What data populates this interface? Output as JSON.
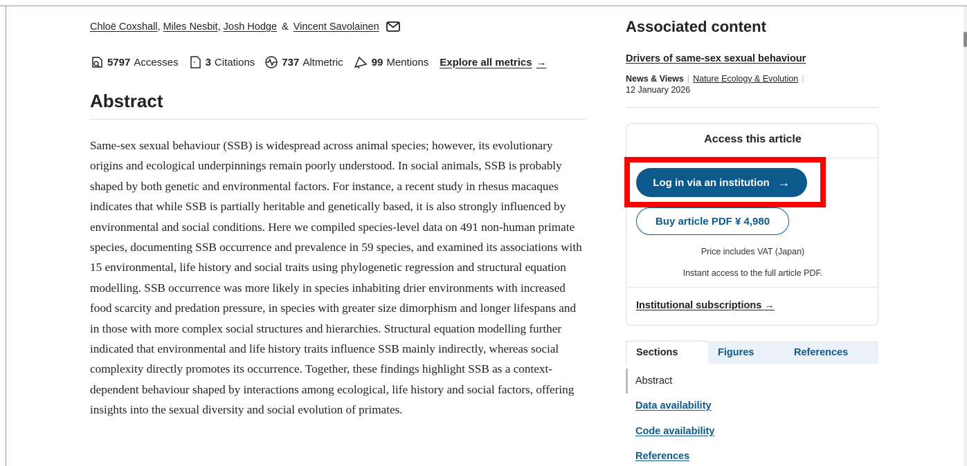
{
  "authors": [
    {
      "name": "Chloë Coxshall"
    },
    {
      "name": "Miles Nesbit"
    },
    {
      "name": "Josh Hodge"
    },
    {
      "name": "Vincent Savolainen"
    }
  ],
  "authors_sep": ",",
  "authors_amp": "&",
  "metrics": {
    "accesses_value": "5797",
    "accesses_label": "Accesses",
    "citations_value": "3",
    "citations_label": "Citations",
    "altmetric_value": "737",
    "altmetric_label": "Altmetric",
    "mentions_value": "99",
    "mentions_label": "Mentions",
    "explore_label": "Explore all metrics",
    "explore_arrow": "→"
  },
  "abstract": {
    "title": "Abstract",
    "body": "Same-sex sexual behaviour (SSB) is widespread across animal species; however, its evolutionary origins and ecological underpinnings remain poorly understood. In social animals, SSB is probably shaped by both genetic and environmental factors. For instance, a recent study in rhesus macaques indicates that while SSB is partially heritable and genetically based, it is also strongly influenced by environmental and social conditions. Here we compiled species-level data on 491 non-human primate species, documenting SSB occurrence and prevalence in 59 species, and examined its associations with 15 environmental, life history and social traits using phylogenetic regression and structural equation modelling. SSB occurrence was more likely in species inhabiting drier environments with increased food scarcity and predation pressure, in species with greater size dimorphism and longer lifespans and in those with more complex social structures and hierarchies. Structural equation modelling further indicated that environmental and life history traits influence SSB mainly indirectly, whereas social complexity directly promotes its occurrence. Together, these findings highlight SSB as a context-dependent behaviour shaped by interactions among ecological, life history and social factors, offering insights into the sexual diversity and social evolution of primates."
  },
  "associated": {
    "title": "Associated content",
    "link_title": "Drivers of same-sex sexual behaviour",
    "type": "News & Views",
    "journal": "Nature Ecology & Evolution",
    "separator": "|",
    "date": "12 January 2026"
  },
  "access": {
    "title": "Access this article",
    "login_label": "Log in via an institution",
    "login_arrow": "→",
    "buy_label": "Buy article PDF ¥ 4,980",
    "vat_note": "Price includes VAT (Japan)",
    "instant_note": "Instant access to the full article PDF.",
    "inst_sub_label": "Institutional subscriptions",
    "inst_sub_arrow": "→"
  },
  "tabs": [
    {
      "label": "Sections",
      "active": true
    },
    {
      "label": "Figures",
      "active": false
    },
    {
      "label": "References",
      "active": false
    }
  ],
  "sections": [
    {
      "label": "Abstract",
      "active": true
    },
    {
      "label": "Data availability",
      "active": false
    },
    {
      "label": "Code availability",
      "active": false
    },
    {
      "label": "References",
      "active": false
    }
  ],
  "colors": {
    "brand_blue": "#0c5a8c",
    "highlight_red": "#ff0000",
    "tab_bg": "#eaf1f8"
  },
  "icons": [
    "mail-icon",
    "accesses-icon",
    "citations-icon",
    "altmetric-icon",
    "mentions-icon",
    "arrow-right-icon"
  ]
}
